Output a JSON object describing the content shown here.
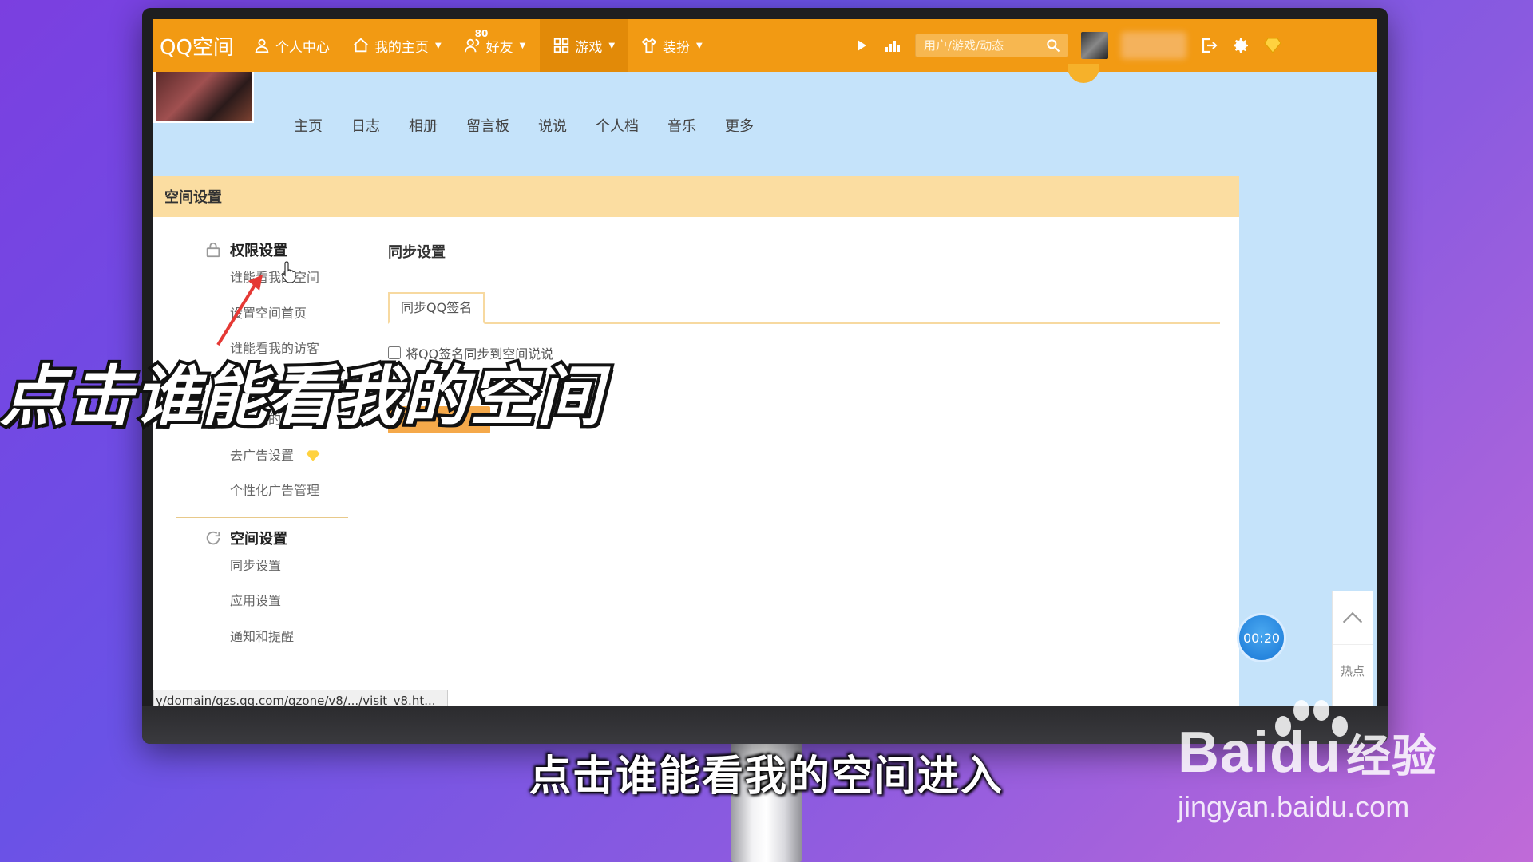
{
  "topnav": {
    "logo": "QQ空间",
    "items": [
      {
        "label": "个人中心",
        "icon": "user-icon"
      },
      {
        "label": "我的主页",
        "icon": "home-icon"
      },
      {
        "label": "好友",
        "icon": "friends-icon",
        "badge": "80"
      },
      {
        "label": "游戏",
        "icon": "grid-icon"
      },
      {
        "label": "装扮",
        "icon": "shirt-icon"
      }
    ],
    "search_placeholder": "用户/游戏/动态"
  },
  "profile_tabs": [
    "主页",
    "日志",
    "相册",
    "留言板",
    "说说",
    "个人档",
    "音乐",
    "更多"
  ],
  "panel": {
    "title": "空间设置",
    "sidebar": {
      "group1": {
        "label": "权限设置",
        "icon": "lock-icon"
      },
      "group1_items": [
        "谁能看我的空间",
        "设置空间首页",
        "谁能看我的访客",
        "封存我的动态",
        "去广告设置",
        "个性化广告管理"
      ],
      "group2": {
        "label": "空间设置",
        "icon": "refresh-icon"
      },
      "group2_items": [
        "同步设置",
        "应用设置",
        "通知和提醒"
      ]
    },
    "content": {
      "title": "同步设置",
      "tab": "同步QQ签名",
      "checkbox_label": "将QQ签名同步到空间说说"
    }
  },
  "timer": "00:20",
  "side_tools": {
    "hot": "热点"
  },
  "statusbar": "y/domain/qzs.qq.com/qzone/v8/.../visit_v8.ht...",
  "overlay": {
    "big_caption": "点击谁能看我的空间",
    "sub_caption": "点击谁能看我的空间进入"
  },
  "watermark": {
    "logo": "Bai",
    "logo_du": "du",
    "logo_cn": "经验",
    "url": "jingyan.baidu.com"
  },
  "colors": {
    "nav": "#f29a13",
    "panel_head": "#fbdda1",
    "accent": "#f5a94a"
  }
}
